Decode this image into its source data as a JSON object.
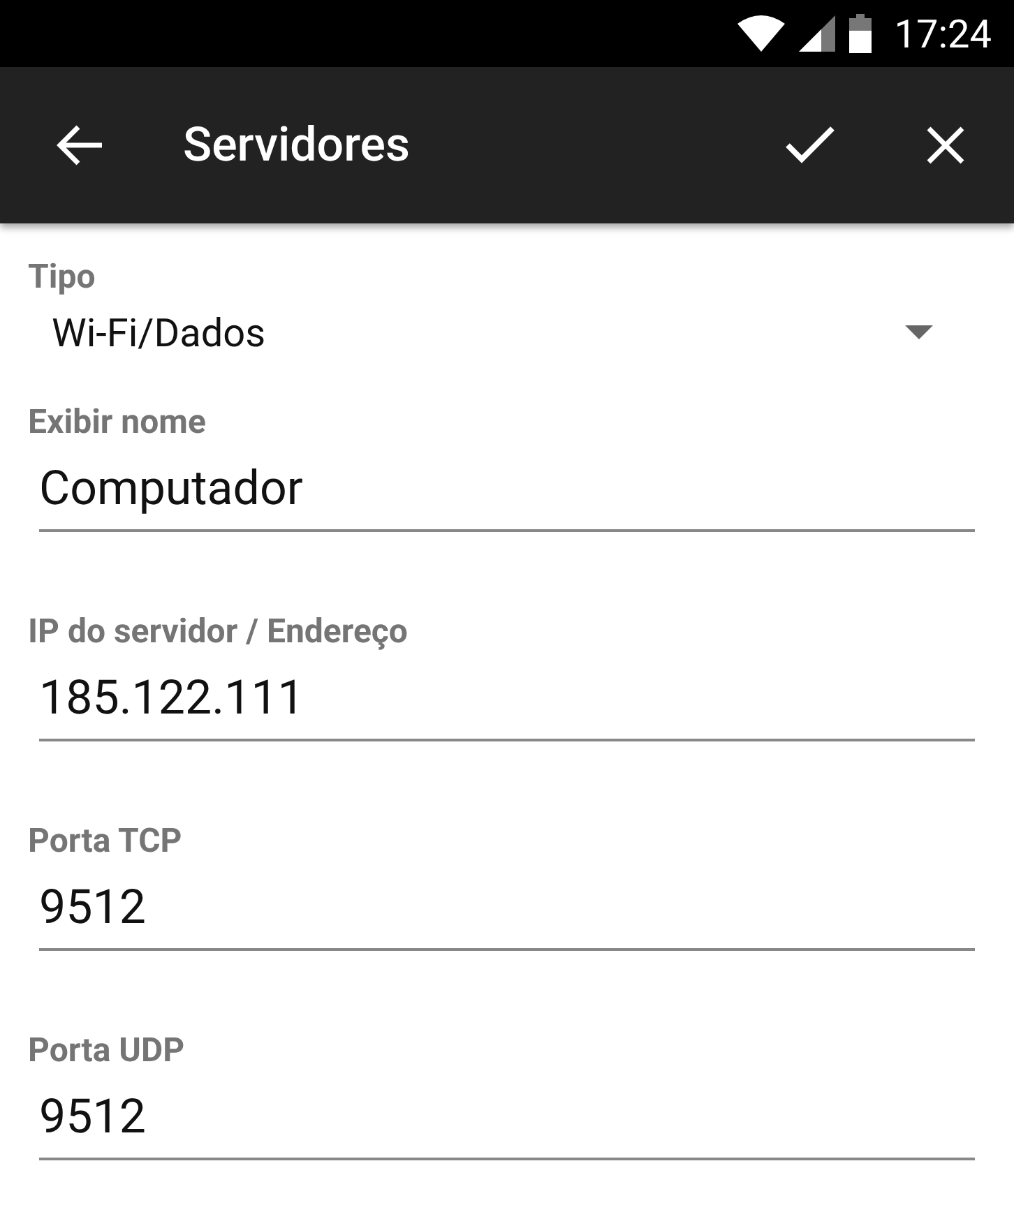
{
  "status_bar": {
    "time": "17:24"
  },
  "app_bar": {
    "title": "Servidores"
  },
  "fields": [
    {
      "kind": "dropdown",
      "label": "Tipo",
      "value": "Wi-Fi/Dados"
    },
    {
      "kind": "text",
      "label": "Exibir nome",
      "value": "Computador"
    },
    {
      "kind": "text",
      "label": "IP do servidor / Endereço",
      "value": "185.122.111"
    },
    {
      "kind": "text",
      "label": "Porta TCP",
      "value": "9512"
    },
    {
      "kind": "text",
      "label": "Porta UDP",
      "value": "9512"
    }
  ]
}
